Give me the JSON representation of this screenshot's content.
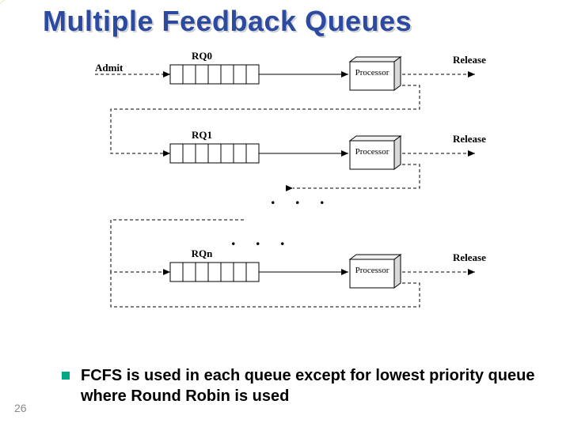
{
  "title": "Multiple Feedback Queues",
  "slide_number": "26",
  "bullet": "FCFS is used in each queue except for lowest priority queue where Round Robin is used",
  "diagram": {
    "admit_label": "Admit",
    "release_label": "Release",
    "processor_label": "Processor",
    "queues": [
      "RQ0",
      "RQ1",
      "RQn"
    ],
    "ellipsis": ". . ."
  }
}
